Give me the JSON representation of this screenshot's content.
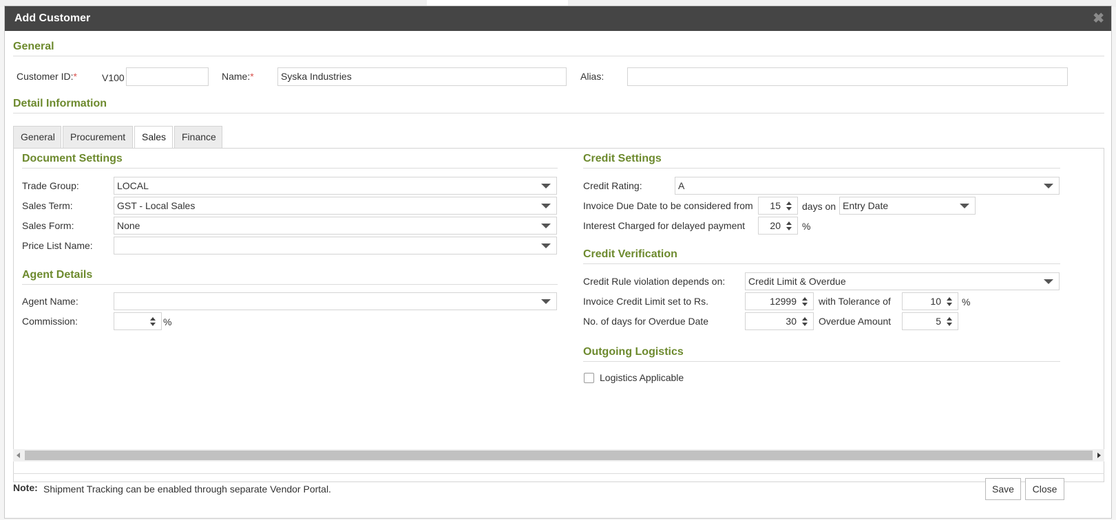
{
  "dialog": {
    "title": "Add Customer",
    "close_glyph": "✖"
  },
  "general": {
    "section_title": "General",
    "customer_id_label": "Customer ID:",
    "customer_id_prefix": "V100",
    "customer_id_value": "",
    "name_label": "Name:",
    "name_value": "Syska Industries",
    "alias_label": "Alias:",
    "alias_value": "",
    "required_mark": "*"
  },
  "detail": {
    "section_title": "Detail Information",
    "tabs": [
      {
        "label": "General",
        "active": false
      },
      {
        "label": "Procurement",
        "active": false
      },
      {
        "label": "Sales",
        "active": true
      },
      {
        "label": "Finance",
        "active": false
      }
    ]
  },
  "document_settings": {
    "title": "Document Settings",
    "trade_group_label": "Trade Group:",
    "trade_group_value": "LOCAL",
    "sales_term_label": "Sales Term:",
    "sales_term_value": "GST - Local Sales",
    "sales_form_label": "Sales Form:",
    "sales_form_value": "None",
    "price_list_label": "Price List Name:",
    "price_list_value": ""
  },
  "agent_details": {
    "title": "Agent Details",
    "agent_name_label": "Agent Name:",
    "agent_name_value": "",
    "commission_label": "Commission:",
    "commission_value": "",
    "percent": "%"
  },
  "credit_settings": {
    "title": "Credit Settings",
    "credit_rating_label": "Credit Rating:",
    "credit_rating_value": "A",
    "due_date_label": "Invoice Due Date to be considered from",
    "due_days_value": "15",
    "days_on_label": "days on",
    "days_on_value": "Entry Date",
    "interest_label": "Interest Charged for delayed payment",
    "interest_value": "20",
    "percent": "%"
  },
  "credit_verification": {
    "title": "Credit Verification",
    "rule_label": "Credit Rule violation depends on:",
    "rule_value": "Credit Limit & Overdue",
    "limit_label": "Invoice Credit Limit set to Rs.",
    "limit_value": "12999",
    "tolerance_label": "with Tolerance of",
    "tolerance_value": "10",
    "percent": "%",
    "overdue_days_label": "No. of days for Overdue Date",
    "overdue_days_value": "30",
    "overdue_amount_label": "Overdue Amount",
    "overdue_amount_value": "5"
  },
  "logistics": {
    "title": "Outgoing Logistics",
    "applicable_label": "Logistics Applicable",
    "applicable_checked": false
  },
  "footer": {
    "note_label": "Note:",
    "note_text": "Shipment Tracking can be enabled through separate Vendor Portal.",
    "save_label": "Save",
    "close_label": "Close"
  }
}
